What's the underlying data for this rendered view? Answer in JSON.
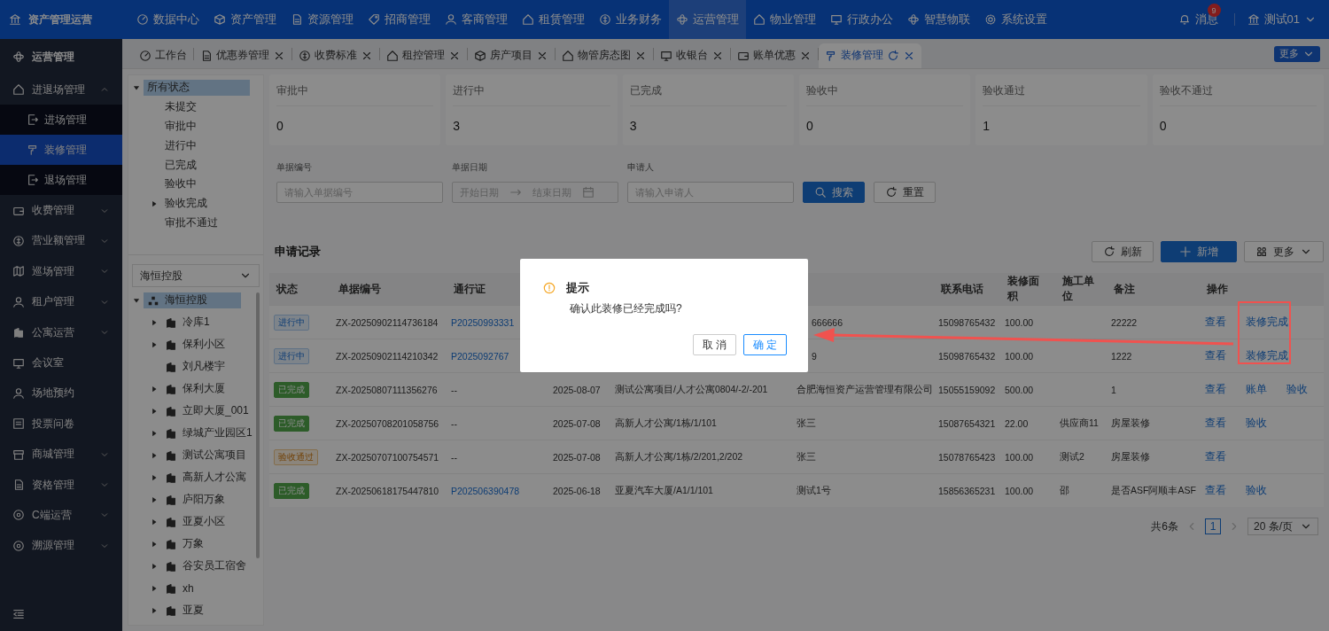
{
  "app": {
    "title": "资产管理运营"
  },
  "top_nav": [
    {
      "label": "数据中心",
      "selected": false
    },
    {
      "label": "资产管理",
      "selected": false
    },
    {
      "label": "资源管理",
      "selected": false
    },
    {
      "label": "招商管理",
      "selected": false
    },
    {
      "label": "客商管理",
      "selected": false
    },
    {
      "label": "租赁管理",
      "selected": false
    },
    {
      "label": "业务财务",
      "selected": false
    },
    {
      "label": "运营管理",
      "selected": true
    },
    {
      "label": "物业管理",
      "selected": false
    },
    {
      "label": "行政办公",
      "selected": false
    },
    {
      "label": "智慧物联",
      "selected": false
    },
    {
      "label": "系统设置",
      "selected": false
    }
  ],
  "messages": {
    "label": "消息",
    "badge": "9"
  },
  "user": {
    "name": "测试01"
  },
  "sidebar": {
    "title": "运营管理",
    "items": [
      {
        "label": "进退场管理",
        "kind": "group",
        "expanded": true,
        "children": [
          {
            "label": "进场管理",
            "selected": false
          },
          {
            "label": "装修管理",
            "selected": true
          },
          {
            "label": "退场管理",
            "selected": false
          }
        ]
      },
      {
        "label": "收费管理",
        "kind": "group",
        "expanded": false
      },
      {
        "label": "营业额管理",
        "kind": "group",
        "expanded": false
      },
      {
        "label": "巡场管理",
        "kind": "group",
        "expanded": false
      },
      {
        "label": "租户管理",
        "kind": "group",
        "expanded": false
      },
      {
        "label": "公寓运营",
        "kind": "group",
        "expanded": false
      },
      {
        "label": "会议室",
        "kind": "link"
      },
      {
        "label": "场地预约",
        "kind": "link"
      },
      {
        "label": "投票问卷",
        "kind": "link"
      },
      {
        "label": "商城管理",
        "kind": "group",
        "expanded": false
      },
      {
        "label": "资格管理",
        "kind": "group",
        "expanded": false
      },
      {
        "label": "C端运营",
        "kind": "group",
        "expanded": false
      },
      {
        "label": "溯源管理",
        "kind": "group",
        "expanded": false
      }
    ]
  },
  "tabs": [
    {
      "label": "工作台",
      "selected": false,
      "kind": "pinned"
    },
    {
      "label": "优惠券管理",
      "selected": false,
      "kind": "normal"
    },
    {
      "label": "收费标准",
      "selected": false,
      "kind": "normal"
    },
    {
      "label": "租控管理",
      "selected": false,
      "kind": "normal"
    },
    {
      "label": "房产项目",
      "selected": false,
      "kind": "normal"
    },
    {
      "label": "物管房态图",
      "selected": false,
      "kind": "normal"
    },
    {
      "label": "收银台",
      "selected": false,
      "kind": "normal"
    },
    {
      "label": "账单优惠",
      "selected": false,
      "kind": "normal"
    },
    {
      "label": "装修管理",
      "selected": true,
      "kind": "normal"
    }
  ],
  "more_tabs_button": "更多",
  "status_tree": {
    "label": "所有状态",
    "selected": true,
    "expanded": true,
    "children": [
      {
        "label": "未提交",
        "kind": "leaf"
      },
      {
        "label": "审批中",
        "kind": "leaf"
      },
      {
        "label": "进行中",
        "kind": "leaf"
      },
      {
        "label": "已完成",
        "kind": "leaf"
      },
      {
        "label": "验收中",
        "kind": "leaf"
      },
      {
        "label": "验收完成",
        "kind": "branch",
        "expanded": false
      },
      {
        "label": "审批不通过",
        "kind": "leaf"
      }
    ]
  },
  "org_select": {
    "value": "海恒控股"
  },
  "org_tree": {
    "label": "海恒控股",
    "selected": true,
    "expanded": true,
    "children": [
      {
        "label": "冷库1",
        "kind": "branch",
        "expanded": false
      },
      {
        "label": "保利小区",
        "kind": "branch",
        "expanded": false
      },
      {
        "label": "刘凡楼宇",
        "kind": "leaf"
      },
      {
        "label": "保利大厦",
        "kind": "branch",
        "expanded": false
      },
      {
        "label": "立即大厦_001",
        "kind": "branch",
        "expanded": false
      },
      {
        "label": "绿城产业园区1",
        "kind": "branch",
        "expanded": false
      },
      {
        "label": "测试公寓项目",
        "kind": "branch",
        "expanded": false
      },
      {
        "label": "高新人才公寓",
        "kind": "branch",
        "expanded": false
      },
      {
        "label": "庐阳万象",
        "kind": "branch",
        "expanded": false
      },
      {
        "label": "亚夏小区",
        "kind": "branch",
        "expanded": false
      },
      {
        "label": "万象",
        "kind": "branch",
        "expanded": false
      },
      {
        "label": "谷安员工宿舍",
        "kind": "branch",
        "expanded": false
      },
      {
        "label": "xh",
        "kind": "branch",
        "expanded": false
      },
      {
        "label": "亚夏",
        "kind": "branch",
        "expanded": false
      }
    ]
  },
  "stats": [
    {
      "label": "审批中",
      "value": "0"
    },
    {
      "label": "进行中",
      "value": "3"
    },
    {
      "label": "已完成",
      "value": "3"
    },
    {
      "label": "验收中",
      "value": "0"
    },
    {
      "label": "验收通过",
      "value": "1"
    },
    {
      "label": "验收不通过",
      "value": "0"
    }
  ],
  "filters": {
    "number": {
      "label": "单据编号",
      "placeholder": "请输入单据编号"
    },
    "date": {
      "label": "单据日期",
      "start_placeholder": "开始日期",
      "end_placeholder": "结束日期"
    },
    "applicant": {
      "label": "申请人",
      "placeholder": "请输入申请人"
    },
    "search_button": "搜索",
    "reset_button": "重置"
  },
  "records": {
    "title": "申请记录",
    "refresh_button": "刷新",
    "add_button": "新增",
    "more_button": "更多",
    "columns": [
      "状态",
      "单据编号",
      "通行证",
      null,
      null,
      null,
      "联系电话",
      "装修面积",
      "施工单位",
      "备注",
      "操作"
    ],
    "rows": [
      {
        "status": {
          "label": "进行中",
          "kind": "progress"
        },
        "number": "ZX-20250902114736184",
        "pass": "P20250993331",
        "date": null,
        "room": null,
        "applicant": "666666",
        "phone": "15098765432",
        "area": "100.00",
        "contractor": null,
        "remark": "22222",
        "actions": [
          "查看",
          "装修完成"
        ]
      },
      {
        "status": {
          "label": "进行中",
          "kind": "progress"
        },
        "number": "ZX-20250902114210342",
        "pass": "P2025092767",
        "date": null,
        "room": null,
        "applicant": "9",
        "phone": "15098765432",
        "area": "100.00",
        "contractor": null,
        "remark": "1222",
        "actions": [
          "查看",
          "装修完成"
        ]
      },
      {
        "status": {
          "label": "已完成",
          "kind": "done"
        },
        "number": "ZX-20250807111356276",
        "pass": "--",
        "date": "2025-08-07",
        "room": "测试公寓项目/人才公寓0804/-2/-201",
        "applicant": "合肥海恒资产运营管理有限公司",
        "phone": "15055159092",
        "area": "500.00",
        "contractor": null,
        "remark": "1",
        "actions": [
          "查看",
          "账单",
          "验收"
        ]
      },
      {
        "status": {
          "label": "已完成",
          "kind": "done"
        },
        "number": "ZX-20250708201058756",
        "pass": "--",
        "date": "2025-07-08",
        "room": "高新人才公寓/1栋/1/101",
        "applicant": "张三",
        "phone": "15087654321",
        "area": "22.00",
        "contractor": "供应商11",
        "remark": "房屋装修",
        "actions": [
          "查看",
          "验收"
        ]
      },
      {
        "status": {
          "label": "验收通过",
          "kind": "accepted"
        },
        "number": "ZX-20250707100754571",
        "pass": "--",
        "date": "2025-07-08",
        "room": "高新人才公寓/1栋/2/201,2/202",
        "applicant": "张三",
        "phone": "15078765423",
        "area": "100.00",
        "contractor": "测试2",
        "remark": "房屋装修",
        "actions": [
          "查看"
        ]
      },
      {
        "status": {
          "label": "已完成",
          "kind": "done"
        },
        "number": "ZX-20250618175447810",
        "pass": "P202506390478",
        "date": "2025-06-18",
        "room": "亚夏汽车大厦/A1/1/101",
        "applicant": "测试1号",
        "phone": "15856365231",
        "area": "100.00",
        "contractor": "邵",
        "remark": "是否ASF阿顺丰ASF",
        "actions": [
          "查看",
          "验收"
        ]
      }
    ]
  },
  "pagination": {
    "total": "共6条",
    "pages": [
      {
        "label": "1",
        "selected": true
      }
    ],
    "page_size": "20 条/页"
  },
  "dialog": {
    "title": "提示",
    "message": "确认此装修已经完成吗?",
    "buttons": [
      {
        "label": "取 消",
        "kind": "default"
      },
      {
        "label": "确 定",
        "kind": "primary"
      }
    ]
  }
}
